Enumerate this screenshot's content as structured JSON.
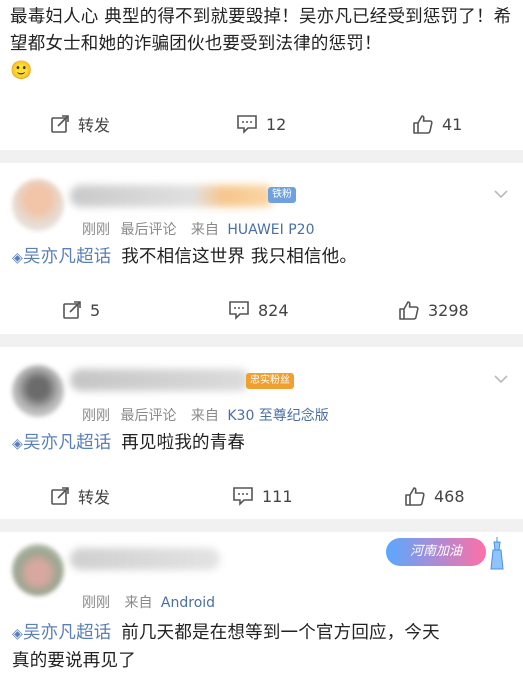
{
  "posts": [
    {
      "text": "最毒妇人心 典型的得不到就要毁掉！吴亦凡已经受到惩罚了！希望都女士和她的诈骗团伙也要受到法律的惩罚！",
      "emoji": "🙂",
      "repost_label": "转发",
      "comments": "12",
      "likes": "41"
    },
    {
      "badge": "铁粉",
      "time": "刚刚",
      "last_comment": "最后评论",
      "from": "来自",
      "device": "HUAWEI P20",
      "topic": "吴亦凡超话",
      "text": "我不相信这世界 我只相信他。",
      "reposts": "5",
      "comments": "824",
      "likes": "3298"
    },
    {
      "badge": "忠实粉丝",
      "time": "刚刚",
      "last_comment": "最后评论",
      "from": "来自",
      "device": "K30 至尊纪念版",
      "topic": "吴亦凡超话",
      "text": "再见啦我的青春",
      "repost_label": "转发",
      "comments": "111",
      "likes": "468"
    },
    {
      "sticker": "河南加油",
      "time": "刚刚",
      "from": "来自",
      "device": "Android",
      "topic": "吴亦凡超话",
      "text_line1": "前几天都是在想等到一个官方回应，今天",
      "text_line2": "真的要说再见了"
    }
  ]
}
